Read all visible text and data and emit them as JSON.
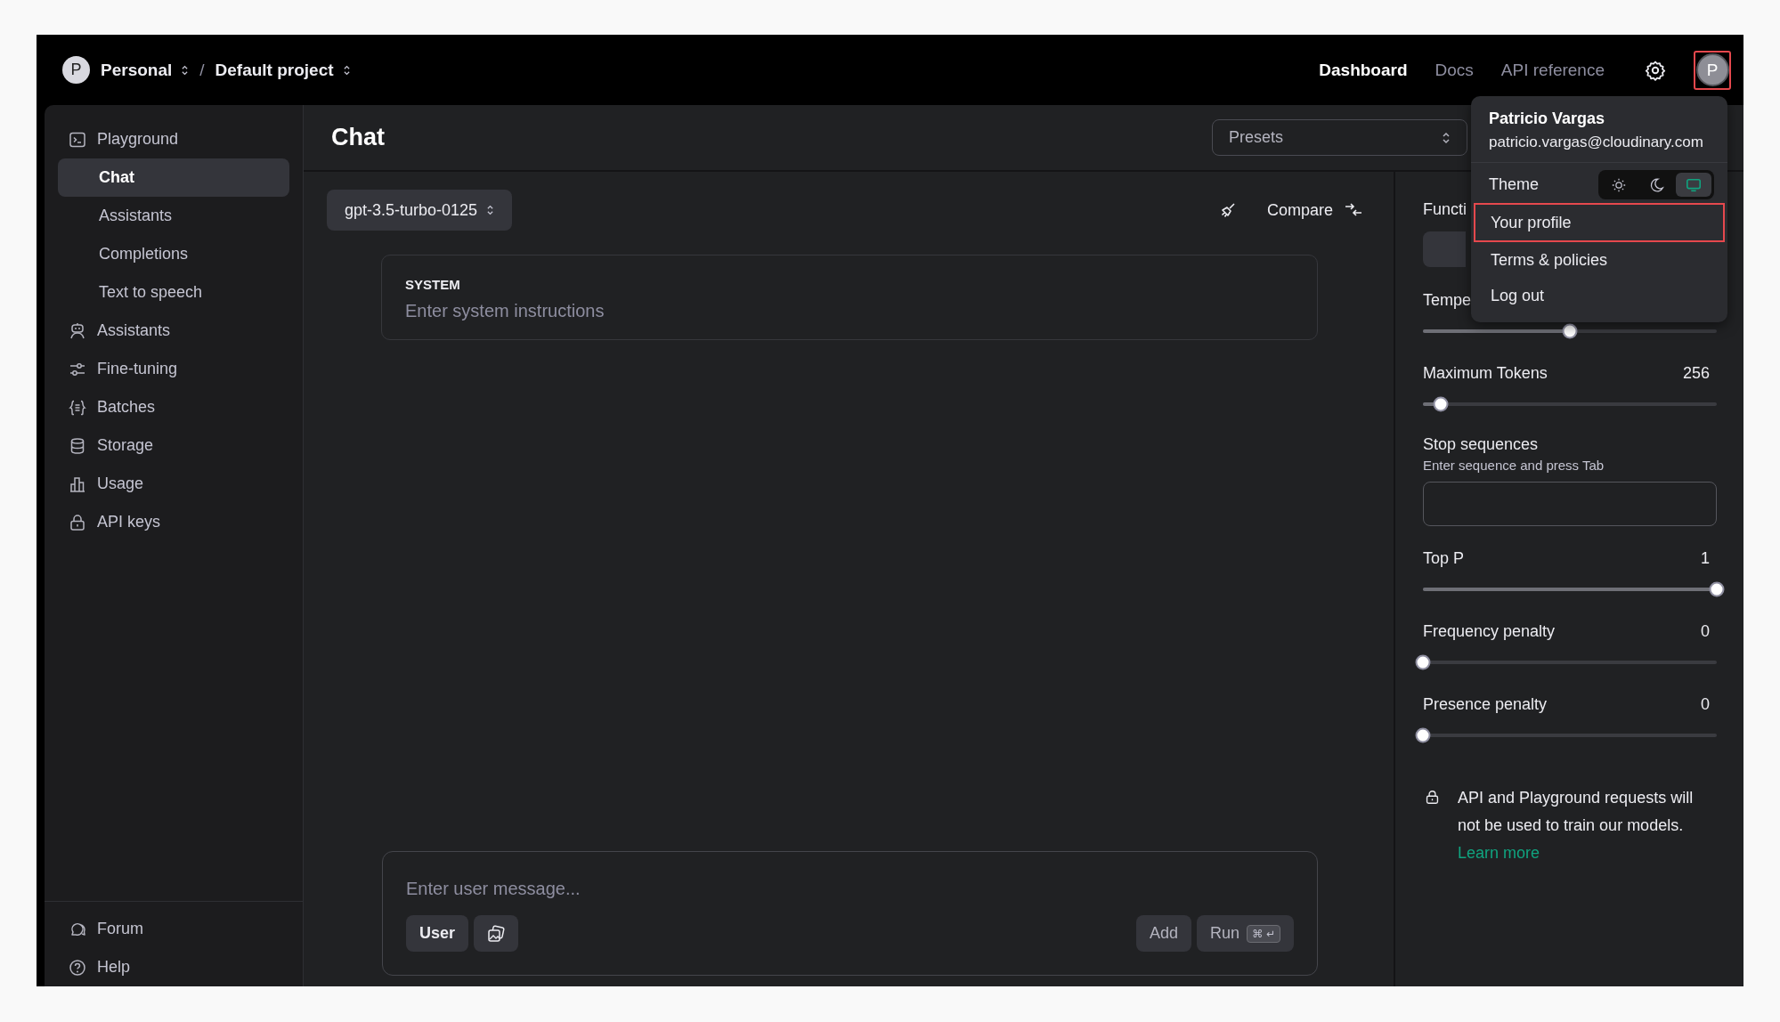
{
  "top_bar": {
    "org_avatar": "P",
    "breadcrumbs": [
      {
        "label": "Personal"
      },
      {
        "label": "Default project"
      }
    ],
    "separator": "/",
    "nav": [
      {
        "label": "Dashboard",
        "selected": true
      },
      {
        "label": "Docs",
        "selected": false
      },
      {
        "label": "API reference",
        "selected": false
      }
    ],
    "user_avatar": {
      "letter": "P",
      "highlighted": true
    }
  },
  "sidebar": {
    "items": [
      {
        "label": "Playground",
        "selected": false,
        "children": [
          {
            "label": "Chat",
            "selected": true
          },
          {
            "label": "Assistants",
            "selected": false
          },
          {
            "label": "Completions",
            "selected": false
          },
          {
            "label": "Text to speech",
            "selected": false
          }
        ]
      },
      {
        "label": "Assistants",
        "selected": false
      },
      {
        "label": "Fine-tuning",
        "selected": false
      },
      {
        "label": "Batches",
        "selected": false
      },
      {
        "label": "Storage",
        "selected": false
      },
      {
        "label": "Usage",
        "selected": false
      },
      {
        "label": "API keys",
        "selected": false
      }
    ],
    "footer_items": [
      {
        "label": "Forum"
      },
      {
        "label": "Help"
      }
    ]
  },
  "header": {
    "title": "Chat",
    "presets": {
      "placeholder": "Presets"
    }
  },
  "chat": {
    "model": "gpt-3.5-turbo-0125",
    "compare": "Compare",
    "system": {
      "label": "SYSTEM",
      "placeholder": "Enter system instructions"
    },
    "message": {
      "placeholder": "Enter user message...",
      "role": "User",
      "add": "Add",
      "run": "Run",
      "shortcut": "⌘ ↵"
    }
  },
  "settings": {
    "functions_label": "Functi",
    "sliders": [
      {
        "label": "Tempe",
        "level": 0.5
      },
      {
        "label": "Maximum Tokens",
        "reading": "256",
        "level": 0.06
      },
      {
        "label": "Top P",
        "reading": "1",
        "level": 1
      },
      {
        "label": "Frequency penalty",
        "reading": "0",
        "level": 0
      },
      {
        "label": "Presence penalty",
        "reading": "0",
        "level": 0
      }
    ],
    "stop_sequences": {
      "label": "Stop sequences",
      "hint": "Enter sequence and press Tab"
    },
    "notice": {
      "text": "API and Playground requests will not be used to train our models.",
      "link": "Learn more"
    }
  },
  "account_menu": {
    "name": "Patricio Vargas",
    "email": "patricio.vargas@cloudinary.com",
    "theme": {
      "label": "Theme",
      "options": [
        {
          "selected": false
        },
        {
          "selected": false
        },
        {
          "selected": true
        }
      ]
    },
    "items": [
      {
        "label": "Your profile",
        "highlighted": true
      },
      {
        "label": "Terms & policies",
        "highlighted": false
      },
      {
        "label": "Log out",
        "highlighted": false
      }
    ]
  }
}
